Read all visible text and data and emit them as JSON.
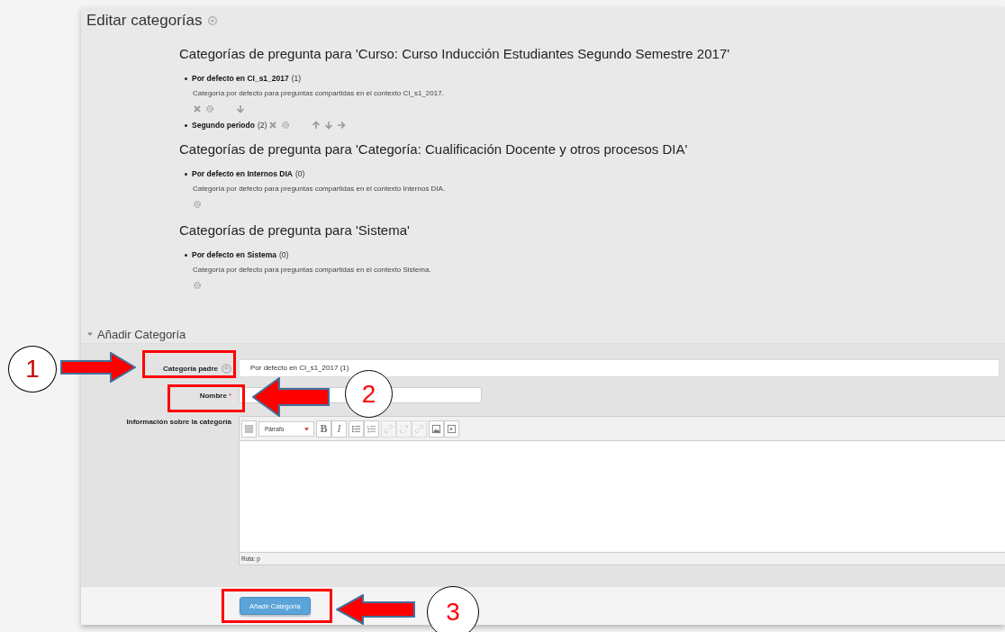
{
  "page_title": "Editar categorías",
  "contexts": [
    {
      "heading": "Categorías de pregunta para 'Curso: Curso Inducción Estudiantes Segundo Semestre 2017'",
      "items": [
        {
          "name": "Por defecto en CI_s1_2017",
          "count": "(1)",
          "description": "Categoría por defecto para preguntas compartidas en el contexto CI_s1_2017.",
          "actions": [
            {
              "kind": "delete"
            },
            {
              "kind": "settings"
            },
            {
              "kind": "down"
            }
          ]
        },
        {
          "name": "Segundo periodo",
          "count": "(2)",
          "actions": [
            {
              "kind": "delete"
            },
            {
              "kind": "settings"
            },
            {
              "kind": "up"
            },
            {
              "kind": "down"
            },
            {
              "kind": "right"
            }
          ]
        }
      ]
    },
    {
      "heading": "Categorías de pregunta para 'Categoría: Cualificación Docente y otros procesos DIA'",
      "items": [
        {
          "name": "Por defecto en Internos DIA",
          "count": "(0)",
          "description": "Categoría por defecto para preguntas compartidas en el contexto Internos DIA.",
          "actions": [
            {
              "kind": "settings"
            }
          ]
        }
      ]
    },
    {
      "heading": "Categorías de pregunta para 'Sistema'",
      "items": [
        {
          "name": "Por defecto en Sistema",
          "count": "(0)",
          "description": "Categoría por defecto para preguntas compartidas en el contexto Sistema.",
          "actions": [
            {
              "kind": "settings"
            }
          ]
        }
      ]
    }
  ],
  "add_section": {
    "legend": "Añadir Categoría",
    "expanded": true,
    "parent_label": "Categoría padre",
    "parent_value": "Por defecto en CI_s1_2017 (1)",
    "name_label": "Nombre",
    "required_mark": "*",
    "info_label": "Información sobre la categoría",
    "toolbar": [
      [
        {
          "kind": "grid",
          "disabled": false
        }
      ],
      [
        {
          "kind": "select",
          "label": "Párrafo",
          "disabled": false
        }
      ],
      [
        {
          "kind": "bold",
          "label": "B",
          "disabled": false
        },
        {
          "kind": "italic",
          "label": "I",
          "disabled": false
        }
      ],
      [
        {
          "kind": "bullets",
          "disabled": false
        },
        {
          "kind": "numbers",
          "disabled": false
        }
      ],
      [
        {
          "kind": "link",
          "disabled": true
        },
        {
          "kind": "unlink",
          "disabled": true
        },
        {
          "kind": "link",
          "disabled": true
        }
      ],
      [
        {
          "kind": "image",
          "disabled": false
        },
        {
          "kind": "media",
          "disabled": false
        }
      ]
    ],
    "path": "Ruta: p",
    "submit": "Añadir Categoría"
  },
  "annotations": [
    {
      "number": "1"
    },
    {
      "number": "2"
    },
    {
      "number": "3"
    }
  ]
}
